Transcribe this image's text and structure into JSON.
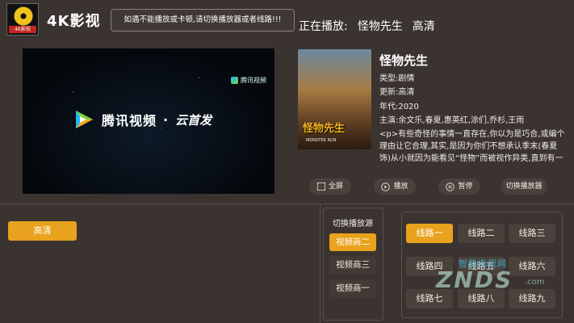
{
  "header": {
    "app_name": "4K影视",
    "logo_badge": "4K影视",
    "notice": "如遇不能播放或卡顿,请切换播放器或者线路!!!",
    "now_playing_label": "正在播放:",
    "now_playing_title": "怪物先生",
    "now_playing_quality": "高清"
  },
  "video": {
    "watermark": "腾讯视频",
    "brand_text": "腾讯视频",
    "brand_dot": "·",
    "brand_sub": "云首发"
  },
  "info": {
    "poster_title": "怪物先生",
    "poster_subtitle": "MONSTER RUN",
    "title": "怪物先生",
    "type": "类型:剧情",
    "update": "更新:高清",
    "year": "年代:2020",
    "cast": "主演:余文乐,春夏,惠英红,涂们,乔杉,王雨",
    "description": "<p>有些奇怪的事情一直存在,你以为是巧合,或编个理由让它合理,其实,是因为你们不想承认季末(春夏 饰)从小就因为能看见“怪物”而被视作异类,直到有一天她"
  },
  "controls": {
    "fullscreen": "全屏",
    "play": "播放",
    "pause": "暂停",
    "switch_player": "切换播放器"
  },
  "quality": {
    "label": "高清"
  },
  "sources": {
    "header": "切换播放源",
    "items": [
      "视频商二",
      "视频商三",
      "视频商一"
    ],
    "active_index": 0
  },
  "routes": {
    "items": [
      "线路一",
      "线路二",
      "线路三",
      "线路四",
      "线路五",
      "线路六",
      "线路七",
      "线路八",
      "线路九"
    ],
    "active_index": 0
  },
  "overlay_watermark": {
    "top": "智能电视网",
    "main": "ZNDS",
    "suffix": ".com"
  },
  "colors": {
    "accent": "#e9a21d",
    "background": "#3a3330",
    "button": "#4a413c"
  }
}
